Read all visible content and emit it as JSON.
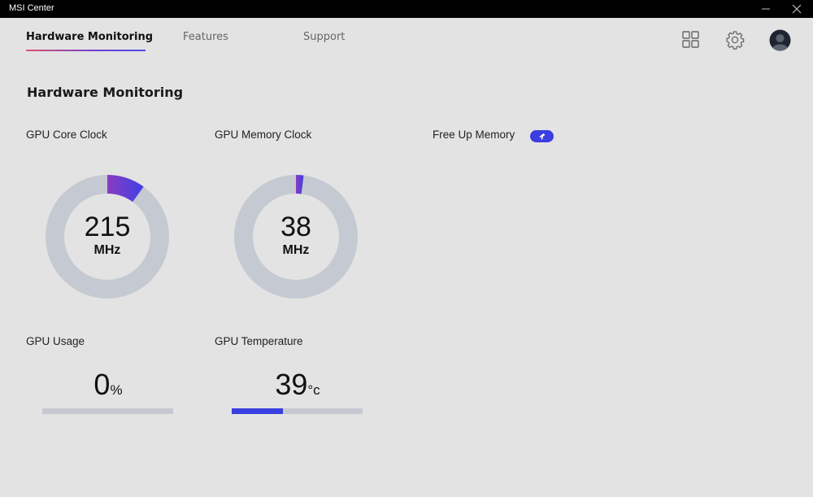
{
  "window": {
    "title": "MSI Center"
  },
  "tabs": [
    {
      "label": "Hardware Monitoring",
      "active": true
    },
    {
      "label": "Features",
      "active": false
    },
    {
      "label": "Support",
      "active": false
    }
  ],
  "header_icons": [
    "grid-icon",
    "gear-icon",
    "avatar-icon"
  ],
  "page_title": "Hardware Monitoring",
  "gpu_core_clock": {
    "label": "GPU Core Clock",
    "value": "215",
    "unit": "MHz",
    "fill_fraction": 0.1
  },
  "gpu_memory_clock": {
    "label": "GPU Memory Clock",
    "value": "38",
    "unit": "MHz",
    "fill_fraction": 0.02
  },
  "free_up_memory": {
    "label": "Free Up Memory",
    "icon": "rocket-icon"
  },
  "gpu_usage": {
    "label": "GPU Usage",
    "value": "0",
    "unit": "%",
    "fill_fraction": 0.0
  },
  "gpu_temperature": {
    "label": "GPU Temperature",
    "value": "39",
    "unit": "°C",
    "unit_display": "°c",
    "fill_fraction": 0.39
  },
  "colors": {
    "accent": "#3b3fe0",
    "gauge_track": "#c5c9d2",
    "gauge_start": "#8a3cc0",
    "gauge_end": "#4a3fe0"
  }
}
